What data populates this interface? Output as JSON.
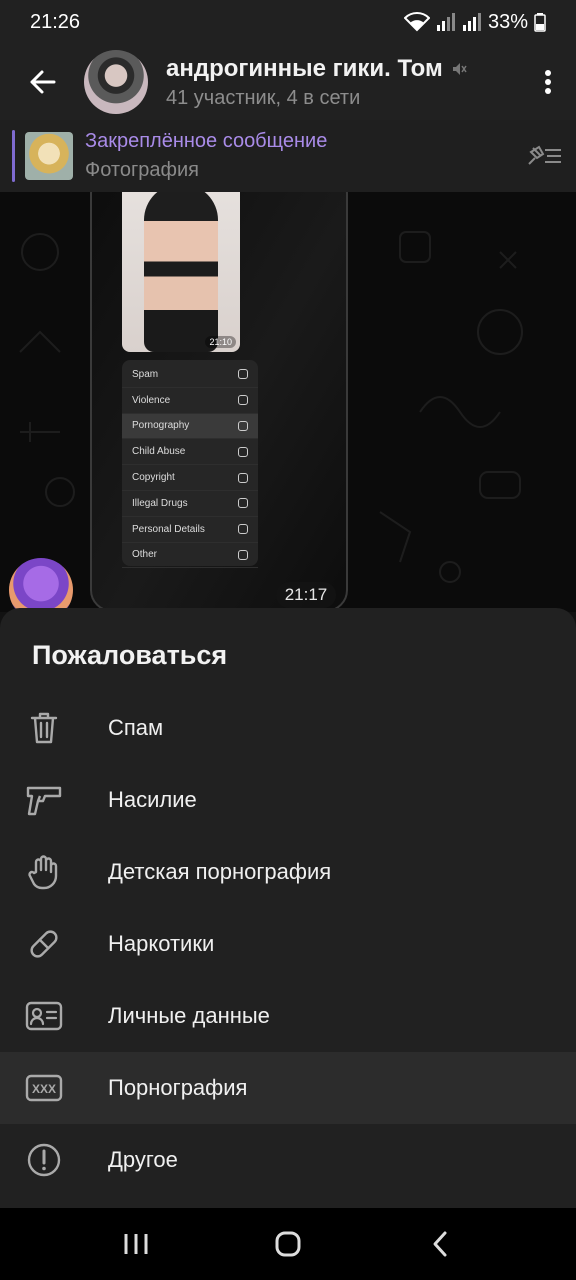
{
  "status_bar": {
    "time": "21:26",
    "battery": "33%"
  },
  "header": {
    "title": "андрогинные гики. Том",
    "subtitle": "41 участник, 4 в сети"
  },
  "pinned": {
    "title": "Закреплённое сообщение",
    "subtitle": "Фотография"
  },
  "message": {
    "time": "21:17",
    "screenshot": {
      "photo_time": "21:10",
      "menu_items": [
        "Spam",
        "Violence",
        "Pornography",
        "Child Abuse",
        "Copyright",
        "Illegal Drugs",
        "Personal Details",
        "Other"
      ]
    }
  },
  "report_sheet": {
    "title": "Пожаловаться",
    "options": [
      {
        "label": "Спам",
        "icon": "trash-icon"
      },
      {
        "label": "Насилие",
        "icon": "gun-icon"
      },
      {
        "label": "Детская порнография",
        "icon": "hand-icon"
      },
      {
        "label": "Наркотики",
        "icon": "pill-icon"
      },
      {
        "label": "Личные данные",
        "icon": "id-card-icon"
      },
      {
        "label": "Порнография",
        "icon": "xxx-icon",
        "selected": true
      },
      {
        "label": "Другое",
        "icon": "info-icon"
      }
    ]
  }
}
